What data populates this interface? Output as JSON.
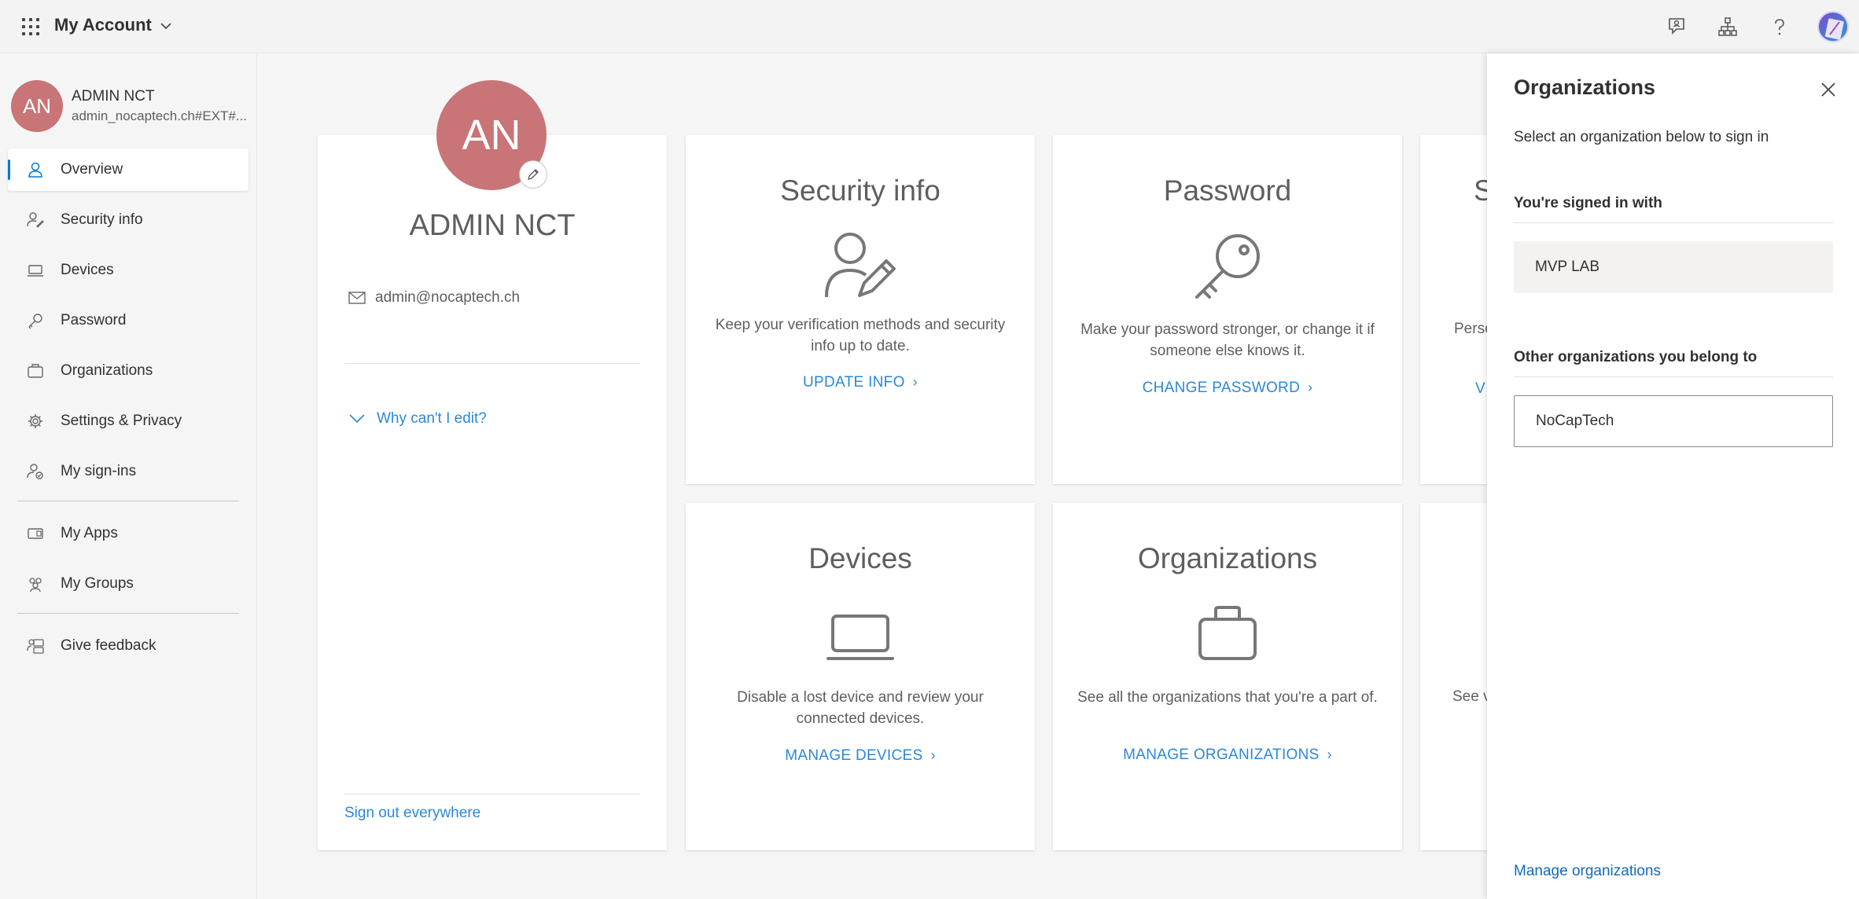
{
  "header": {
    "title": "My Account"
  },
  "sidebar": {
    "profile": {
      "initials": "AN",
      "name": "ADMIN NCT",
      "email": "admin_nocaptech.ch#EXT#..."
    },
    "items": [
      {
        "label": "Overview",
        "icon": "person-icon"
      },
      {
        "label": "Security info",
        "icon": "security-info-icon"
      },
      {
        "label": "Devices",
        "icon": "laptop-icon"
      },
      {
        "label": "Password",
        "icon": "key-icon"
      },
      {
        "label": "Organizations",
        "icon": "briefcase-icon"
      },
      {
        "label": "Settings & Privacy",
        "icon": "gear-icon"
      },
      {
        "label": "My sign-ins",
        "icon": "sign-ins-icon"
      },
      {
        "label": "My Apps",
        "icon": "apps-icon"
      },
      {
        "label": "My Groups",
        "icon": "groups-icon"
      },
      {
        "label": "Give feedback",
        "icon": "feedback-icon"
      }
    ]
  },
  "profile_card": {
    "initials": "AN",
    "name": "ADMIN NCT",
    "email": "admin@nocaptech.ch",
    "why_edit": "Why can't I edit?",
    "sign_out": "Sign out everywhere"
  },
  "cards": {
    "security": {
      "title": "Security info",
      "desc": "Keep your verification methods and security info up to date.",
      "link": "UPDATE INFO"
    },
    "password": {
      "title": "Password",
      "desc": "Make your password stronger, or change it if someone else knows it.",
      "link": "CHANGE PASSWORD"
    },
    "partial_top": {
      "title": "S",
      "desc": "Perso",
      "link": "V"
    },
    "devices": {
      "title": "Devices",
      "desc": "Disable a lost device and review your connected devices.",
      "link": "MANAGE DEVICES"
    },
    "organizations": {
      "title": "Organizations",
      "desc": "See all the organizations that you're a part of.",
      "link": "MANAGE ORGANIZATIONS"
    },
    "partial_bottom": {
      "desc": "See v"
    }
  },
  "panel": {
    "title": "Organizations",
    "subtitle": "Select an organization below to sign in",
    "signed_in_heading": "You're signed in with",
    "current_org": "MVP LAB",
    "other_heading": "Other organizations you belong to",
    "other_orgs": [
      "NoCapTech"
    ],
    "manage_link": "Manage organizations"
  },
  "colors": {
    "accent": "#0078d4",
    "link": "#2b88d8",
    "avatar": "#c97477"
  }
}
